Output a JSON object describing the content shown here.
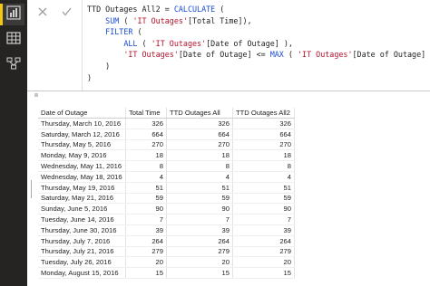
{
  "formula": {
    "measure_name": "TTD Outages All2",
    "lines": [
      [
        "TTD Outages All2 = ",
        "CALCULATE",
        " ("
      ],
      [
        "    ",
        "SUM",
        " ( ",
        "'IT Outages'",
        "[Total Time]),"
      ],
      [
        "    ",
        "FILTER",
        " ("
      ],
      [
        "        ",
        "ALL",
        " ( ",
        "'IT Outages'",
        "[Date of Outage] ),"
      ],
      [
        "        ",
        "'IT Outages'",
        "[Date of Outage] <= ",
        "MAX",
        " ( ",
        "'IT Outages'",
        "[Date of Outage] )"
      ],
      [
        "    )"
      ],
      [
        ")"
      ]
    ]
  },
  "table": {
    "headers": [
      "Date of Outage",
      "Total Time",
      "TTD Outages All",
      "TTD Outages All2"
    ],
    "rows": [
      [
        "Thursday, March 10, 2016",
        "326",
        "326",
        "326"
      ],
      [
        "Saturday, March 12, 2016",
        "664",
        "664",
        "664"
      ],
      [
        "Thursday, May 5, 2016",
        "270",
        "270",
        "270"
      ],
      [
        "Monday, May 9, 2016",
        "18",
        "18",
        "18"
      ],
      [
        "Wednesday, May 11, 2016",
        "8",
        "8",
        "8"
      ],
      [
        "Wednesday, May 18, 2016",
        "4",
        "4",
        "4"
      ],
      [
        "Thursday, May 19, 2016",
        "51",
        "51",
        "51"
      ],
      [
        "Saturday, May 21, 2016",
        "59",
        "59",
        "59"
      ],
      [
        "Sunday, June 5, 2016",
        "90",
        "90",
        "90"
      ],
      [
        "Tuesday, June 14, 2016",
        "7",
        "7",
        "7"
      ],
      [
        "Thursday, June 30, 2016",
        "39",
        "39",
        "39"
      ],
      [
        "Thursday, July 7, 2016",
        "264",
        "264",
        "264"
      ],
      [
        "Thursday, July 21, 2016",
        "279",
        "279",
        "279"
      ],
      [
        "Tuesday, July 26, 2016",
        "20",
        "20",
        "20"
      ],
      [
        "Monday, August 15, 2016",
        "15",
        "15",
        "15"
      ]
    ]
  },
  "icons": {
    "report": "bar-chart-icon",
    "data": "table-grid-icon",
    "model": "relationships-icon",
    "cancel": "close-icon",
    "commit": "checkmark-icon"
  },
  "colors": {
    "rail_bg": "#252423",
    "accent": "#f2c811",
    "keyword": "#1a4bd6",
    "string": "#b5122b"
  }
}
